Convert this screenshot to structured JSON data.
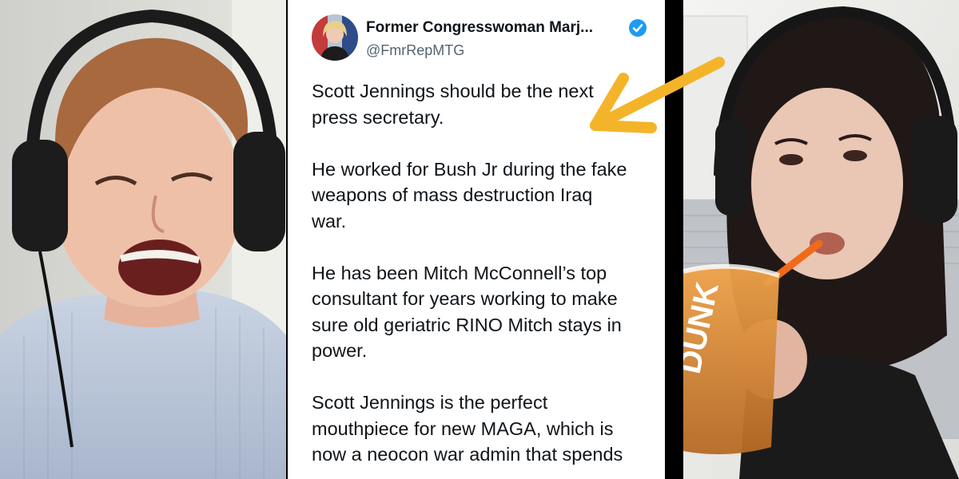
{
  "tweet": {
    "display_name": "Former Congresswoman Marj...",
    "handle": "@FmrRepMTG",
    "paragraphs": [
      "Scott Jennings should be the next\npress secretary.",
      "He worked for Bush Jr during the fake\nweapons of mass destruction Iraq\nwar.",
      "He has been Mitch McConnell’s top\nconsultant for years working to make\nsure old geriatric RINO Mitch stays in\npower.",
      "Scott Jennings is the perfect\nmouthpiece for new MAGA, which is\nnow a neocon war admin that spends"
    ],
    "verified_color": "#1d9bf0"
  },
  "photos": {
    "left": "man-with-headphones-laughing",
    "right": "woman-with-headphones-drinking-iced-coffee",
    "cup_text": "DUNK"
  },
  "annotation": {
    "arrow_color": "#f4b42a"
  }
}
